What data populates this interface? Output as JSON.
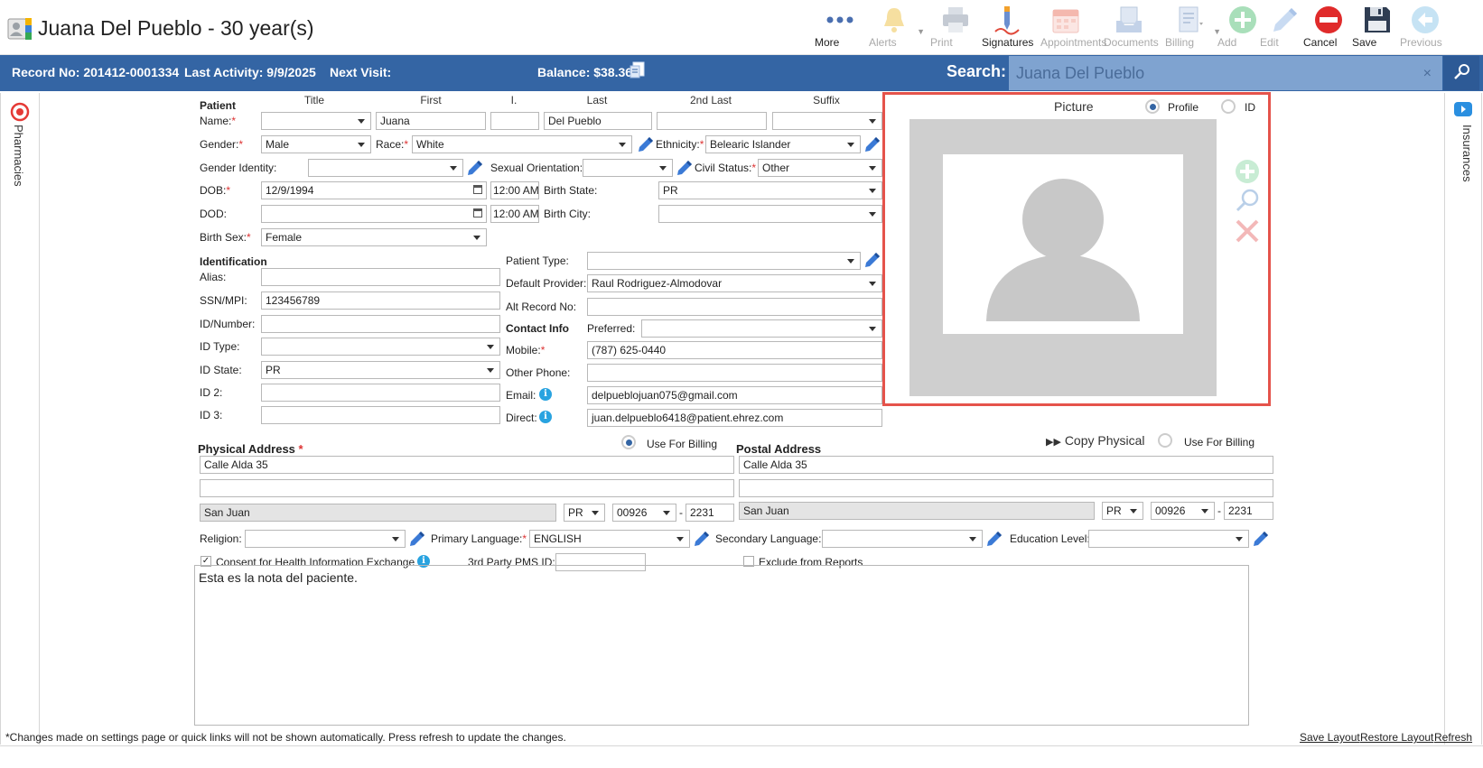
{
  "window": {
    "title": "Juana Del Pueblo - 30 year(s)"
  },
  "toolbar": [
    {
      "id": "more",
      "label": "More",
      "icon": "more-dots-icon",
      "enabled": true
    },
    {
      "id": "alerts",
      "label": "Alerts",
      "icon": "bell-icon",
      "enabled": false
    },
    {
      "id": "print",
      "label": "Print",
      "icon": "printer-icon",
      "enabled": false
    },
    {
      "id": "signatures",
      "label": "Signatures",
      "icon": "signature-pen-icon",
      "enabled": true
    },
    {
      "id": "appointments",
      "label": "Appointments",
      "icon": "calendar-icon",
      "enabled": false
    },
    {
      "id": "documents",
      "label": "Documents",
      "icon": "documents-tray-icon",
      "enabled": false
    },
    {
      "id": "billing",
      "label": "Billing",
      "icon": "billing-icon",
      "enabled": false
    },
    {
      "id": "add",
      "label": "Add",
      "icon": "plus-circle-icon",
      "enabled": false
    },
    {
      "id": "edit",
      "label": "Edit",
      "icon": "pencil-icon",
      "enabled": false
    },
    {
      "id": "cancel",
      "label": "Cancel",
      "icon": "no-entry-icon",
      "enabled": true
    },
    {
      "id": "save",
      "label": "Save",
      "icon": "floppy-disk-icon",
      "enabled": true
    },
    {
      "id": "previous",
      "label": "Previous",
      "icon": "arrow-left-circle-icon",
      "enabled": false
    }
  ],
  "infobar": {
    "record": "Record No: 201412-0001334",
    "last_activity": "Last Activity: 9/9/2025",
    "next_visit": "Next Visit:",
    "balance": "Balance: $38.36",
    "search_label": "Search:",
    "search_placeholder": "Juana Del Pueblo",
    "search_clear": "×"
  },
  "side": {
    "left": "Pharmacies",
    "right": "Insurances"
  },
  "patient": {
    "section": "Patient",
    "headers": {
      "title": "Title",
      "first": "First",
      "initial": "I.",
      "last": "Last",
      "second_last": "2nd Last",
      "suffix": "Suffix"
    },
    "labels": {
      "name": "Name:",
      "gender": "Gender:",
      "race": "Race:",
      "ethnicity": "Ethnicity:",
      "gender_identity": "Gender Identity:",
      "sexual_orientation": "Sexual Orientation:",
      "civil_status": "Civil Status:",
      "dob": "DOB:",
      "birth_state": "Birth State:",
      "dod": "DOD:",
      "birth_city": "Birth City:",
      "birth_sex": "Birth Sex:"
    },
    "values": {
      "title": "",
      "first": "Juana",
      "initial": "",
      "last": "Del Pueblo",
      "second_last": "",
      "suffix": "",
      "gender": "Male",
      "race": "White",
      "ethnicity": "Belearic Islander",
      "gender_identity": "",
      "sexual_orientation": "",
      "civil_status": "Other",
      "dob": "12/9/1994",
      "dob_time": "12:00 AM",
      "birth_state": "PR",
      "dod": "",
      "dod_time": "12:00 AM",
      "birth_city": "",
      "birth_sex": "Female"
    }
  },
  "identification": {
    "section": "Identification",
    "labels": {
      "alias": "Alias:",
      "ssn": "SSN/MPI:",
      "id_number": "ID/Number:",
      "id_type": "ID Type:",
      "id_state": "ID State:",
      "id2": "ID 2:",
      "id3": "ID 3:"
    },
    "values": {
      "alias": "",
      "ssn": "123456789",
      "id_number": "",
      "id_type": "",
      "id_state": "PR",
      "id2": "",
      "id3": ""
    }
  },
  "provider": {
    "labels": {
      "patient_type": "Patient Type:",
      "default_provider": "Default Provider:",
      "alt_record": "Alt Record No:"
    },
    "values": {
      "patient_type": "",
      "default_provider": "Raul Rodriguez-Almodovar",
      "alt_record": ""
    }
  },
  "contact": {
    "section": "Contact Info",
    "labels": {
      "preferred": "Preferred:",
      "mobile": "Mobile:",
      "other_phone": "Other Phone:",
      "email": "Email:",
      "direct": "Direct:"
    },
    "values": {
      "preferred": "",
      "mobile": "(787) 625-0440",
      "other_phone": "",
      "email": "delpueblojuan075@gmail.com",
      "direct": "juan.delpueblo6418@patient.ehrez.com"
    }
  },
  "picture": {
    "title": "Picture",
    "profile": "Profile",
    "id": "ID",
    "selected": "Profile"
  },
  "physical": {
    "section": "Physical Address",
    "use_for_billing": "Use For Billing",
    "line1": "Calle Alda 35",
    "line2": "",
    "city": "San Juan",
    "state": "PR",
    "zip": "00926",
    "zip4": "2231"
  },
  "postal": {
    "section": "Postal Address",
    "copy": "Copy Physical",
    "use_for_billing": "Use For Billing",
    "line1": "Calle Alda 35",
    "line2": "",
    "city": "San Juan",
    "state": "PR",
    "zip": "00926",
    "zip4": "2231"
  },
  "misc": {
    "religion_label": "Religion:",
    "religion": "",
    "primary_language_label": "Primary Language:",
    "primary_language": "ENGLISH",
    "secondary_language_label": "Secondary Language:",
    "secondary_language": "",
    "education_label": "Education Level:",
    "education": "",
    "consent_label": "Consent for Health Information Exchange",
    "consent_checked": true,
    "pms_label": "3rd Party PMS ID:",
    "pms": "",
    "exclude_label": "Exclude from Reports",
    "exclude_checked": false
  },
  "notes": "Esta es la nota del paciente.",
  "footer": {
    "note": "*Changes made on settings page or quick links will not be shown automatically. Press refresh to update the changes.",
    "save_layout": "Save Layout",
    "restore_layout": "Restore Layout",
    "refresh": "Refresh"
  },
  "colors": {
    "header_blue": "#3465a4",
    "search_bg": "#7fa3d0",
    "highlight": "#e5534b",
    "required": "#dd3333"
  }
}
